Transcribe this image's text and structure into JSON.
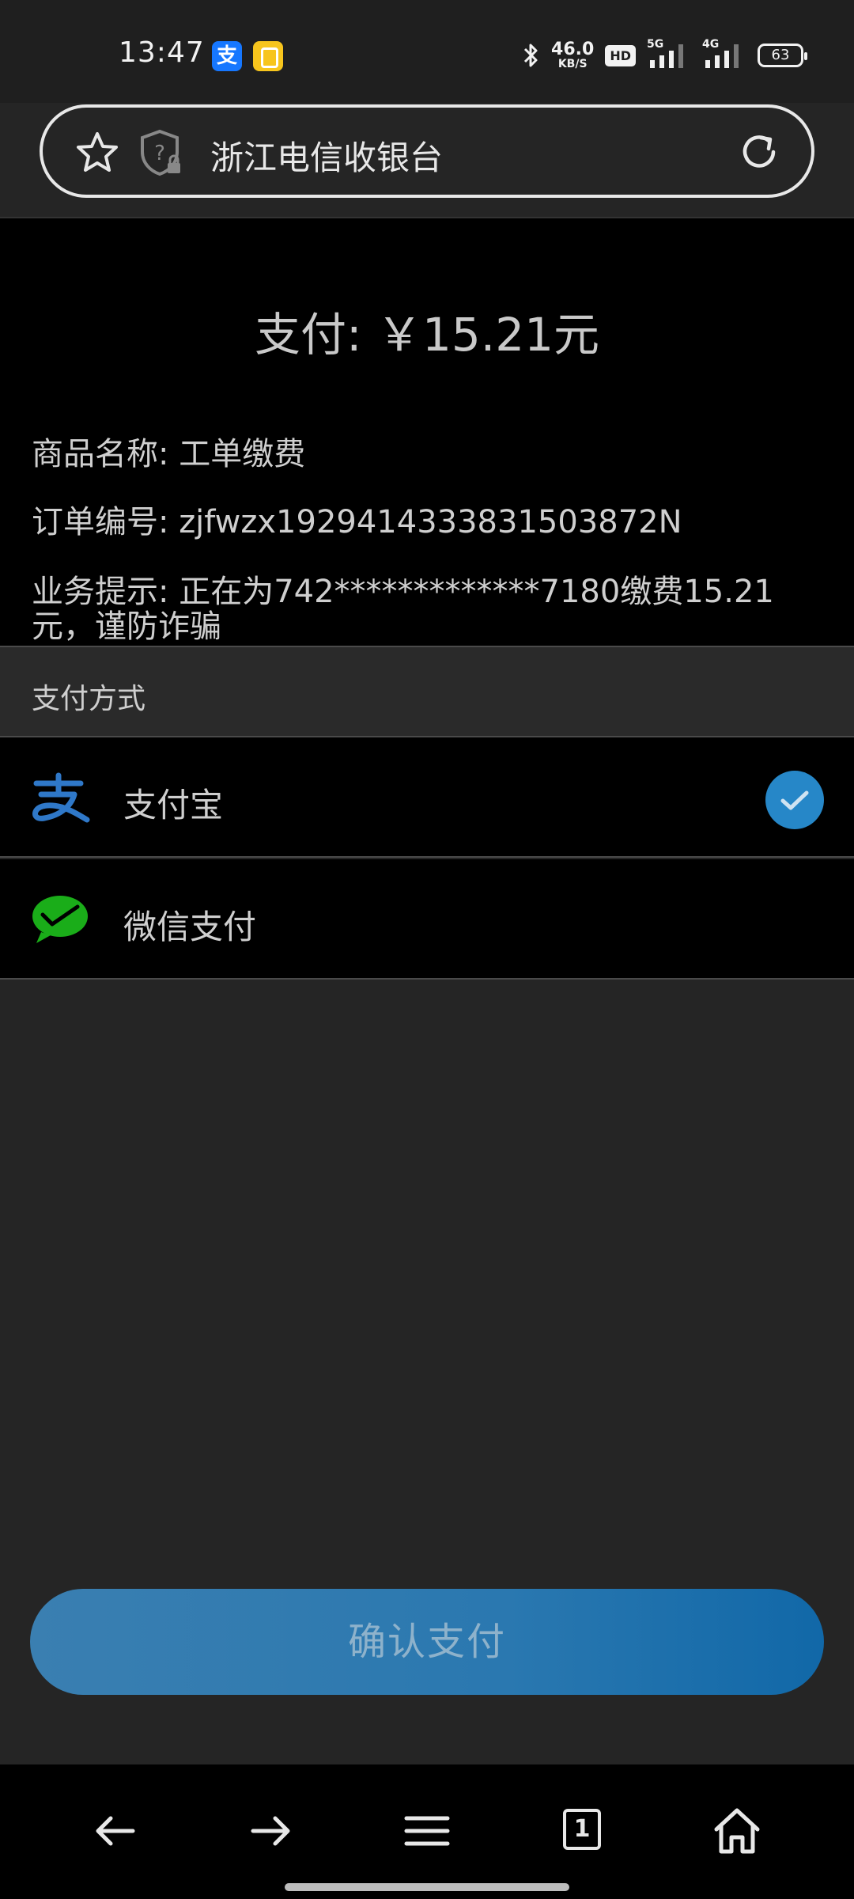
{
  "status_bar": {
    "time": "13:47",
    "alipay_badge": "支",
    "net_speed_value": "46.0",
    "net_speed_unit": "KB/S",
    "hd_badge": "HD",
    "signal_1_label": "5G",
    "signal_2_label": "4G",
    "battery": "63"
  },
  "address_bar": {
    "title": "浙江电信收银台",
    "icons": [
      "star-icon",
      "shield-question-icon",
      "reload-icon"
    ]
  },
  "order": {
    "amount": "支付: ￥15.21元",
    "product_name": "商品名称: 工单缴费",
    "order_number": "订单编号: zjfwzx1929414333831503872N",
    "business_tip": "业务提示: 正在为742*************7180缴费15.21元，谨防诈骗"
  },
  "payment": {
    "section_title": "支付方式",
    "methods": [
      {
        "label": "支付宝",
        "icon": "alipay-icon",
        "selected": true
      },
      {
        "label": "微信支付",
        "icon": "wechat-pay-icon",
        "selected": false
      }
    ]
  },
  "confirm_label": "确认支付",
  "bottom_nav": {
    "tab_count": "1",
    "icons": [
      "back-arrow-icon",
      "forward-arrow-icon",
      "menu-icon",
      "tabs-icon",
      "home-icon"
    ]
  },
  "colors": {
    "accent": "#2687c8",
    "alipay": "#1677ff",
    "wechat": "#1aad19",
    "panel": "#000000",
    "background": "#252525"
  }
}
